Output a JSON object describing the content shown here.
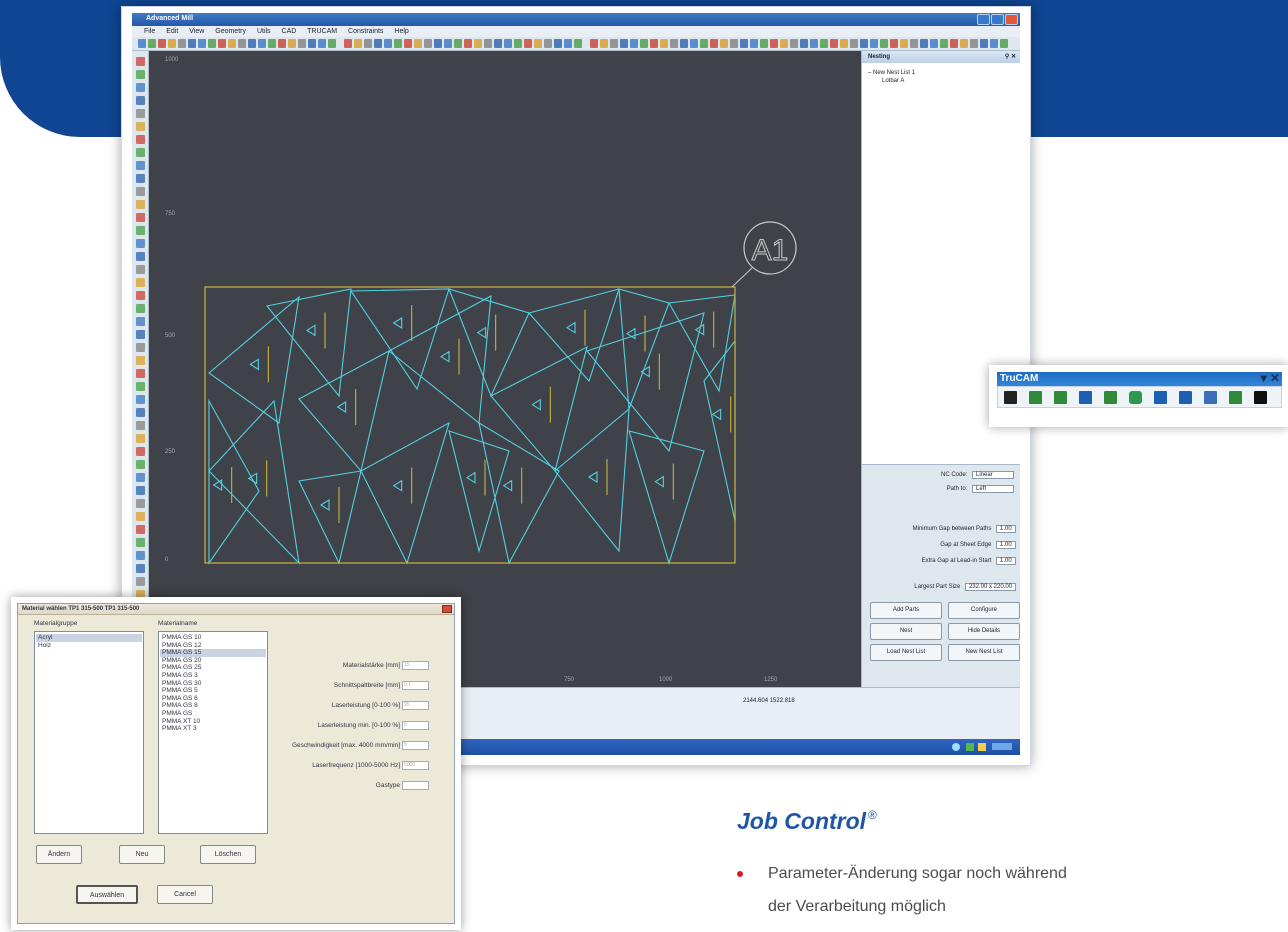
{
  "app": {
    "title": "Advanced Mill",
    "menu": [
      "File",
      "Edit",
      "View",
      "Geometry",
      "Utils",
      "CAD",
      "TRUCAM",
      "Constraints",
      "Help"
    ],
    "canvas": {
      "y_labels": [
        "1000",
        "750",
        "500",
        "250",
        "0"
      ],
      "x_labels": [
        "750",
        "1000",
        "1250"
      ],
      "part_label": "A1"
    },
    "nesting": {
      "header": "Nesting",
      "tree_root": "New Nest List 1",
      "tree_child": "Lotbar A",
      "nc_code_label": "NC Code:",
      "nc_code_value": "Linear",
      "path_to_label": "Path to:",
      "path_to_value": "Left",
      "min_gap_label": "Minimum Gap between Paths",
      "min_gap_value": "1.00",
      "gap_edge_label": "Gap at Sheet Edge",
      "gap_edge_value": "1.00",
      "extra_gap_label": "Extra Gap at Lead-in Start",
      "extra_gap_value": "1.00",
      "largest_label": "Largest Part Size",
      "largest_value": "232.00 x 220.00",
      "buttons": [
        "Add Parts",
        "Configure",
        "Nest",
        "Hide Details",
        "Load Nest List",
        "New Nest List"
      ]
    },
    "status": {
      "coords": "2144.604    1522.818"
    }
  },
  "trucam": {
    "title": "TruCAM",
    "icons": [
      "brush-icon",
      "layers-icon",
      "layers-copy-icon",
      "anchor-icon",
      "route-icon",
      "shape-icon",
      "t-icon",
      "corner-icon",
      "report-icon",
      "map-icon",
      "play-icon"
    ]
  },
  "dialog": {
    "title": "Material wählen TP1 315-500 TP1 315-500",
    "group_label": "Materialgruppe",
    "name_label": "Materialname",
    "groups": [
      "Acryl",
      "Holz"
    ],
    "materials": [
      "PMMA GS 10",
      "PMMA GS 12",
      "PMMA GS 15",
      "PMMA GS 20",
      "PMMA GS 25",
      "PMMA GS 3",
      "PMMA GS 30",
      "PMMA GS 5",
      "PMMA GS 6",
      "PMMA GS 8",
      "PMMA GS",
      "PMMA XT 10",
      "PMMA XT 3"
    ],
    "fields": [
      {
        "label": "Materialstärke [mm]",
        "value": "15"
      },
      {
        "label": "Schnittspaltbreite [mm]",
        "value": "0.1"
      },
      {
        "label": "Laserleistung [0-100 %]",
        "value": "95"
      },
      {
        "label": "Laserleistung min. [0-100 %]",
        "value": "5"
      },
      {
        "label": "Geschwindigkeit [max. 4000 mm/min]",
        "value": "5"
      },
      {
        "label": "Laserfrequenz [1000-5000 Hz]",
        "value": "5000"
      },
      {
        "label": "Gastype",
        "value": ""
      }
    ],
    "buttons": {
      "change": "Ändern",
      "new": "Neu",
      "delete": "Löschen",
      "select": "Auswählen",
      "cancel": "Cancel"
    }
  },
  "job_control": {
    "title": "Job Control",
    "mark": "®",
    "bullet_line1": "Parameter-Änderung sogar noch während",
    "bullet_line2": "der Verarbeitung möglich"
  }
}
